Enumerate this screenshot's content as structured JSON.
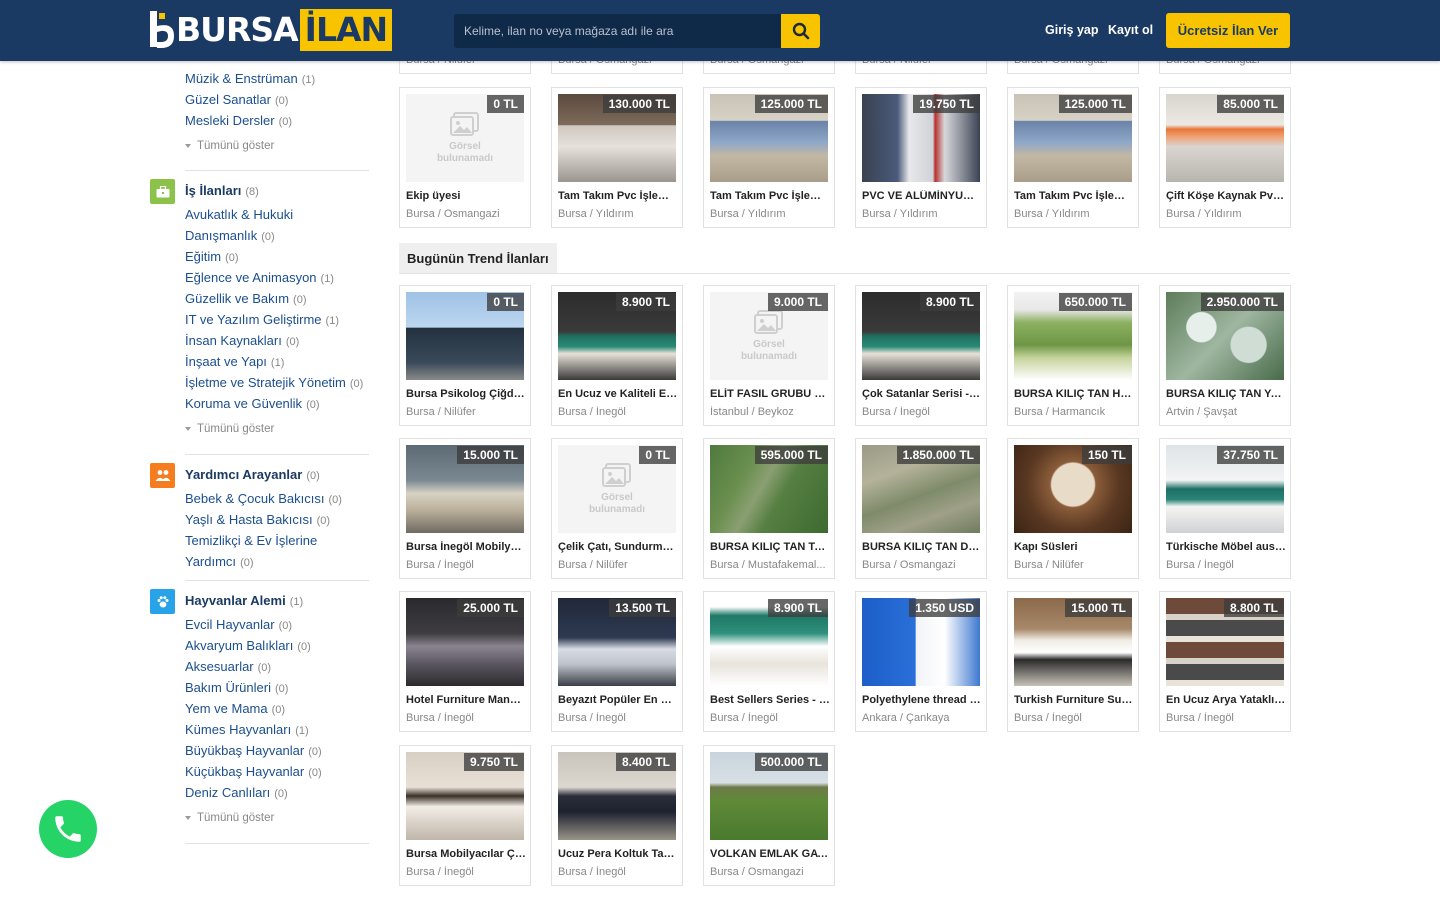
{
  "header": {
    "brand_prefix": "BURSA",
    "brand_suffix": "İLAN",
    "search_placeholder": "Kelime, ilan no veya mağaza adı ile ara",
    "login": "Giriş yap",
    "register": "Kayıt ol",
    "cta": "Ücretsiz İlan Ver"
  },
  "sidebar": {
    "top_items": [
      {
        "label": "Müzik & Enstrüman",
        "count": "(1)"
      },
      {
        "label": "Güzel Sanatlar",
        "count": "(0)"
      },
      {
        "label": "Mesleki Dersler",
        "count": "(0)"
      }
    ],
    "show_all": "Tümünü göster",
    "jobs": {
      "title": "İş İlanları",
      "count": "(8)",
      "items": [
        {
          "label": "Avukatlık & Hukuki",
          "count": ""
        },
        {
          "label": "Danışmanlık",
          "count": "(0)"
        },
        {
          "label": "Eğitim",
          "count": "(0)"
        },
        {
          "label": "Eğlence ve Animasyon",
          "count": "(1)"
        },
        {
          "label": "Güzellik ve Bakım",
          "count": "(0)"
        },
        {
          "label": "IT ve Yazılım Geliştirme",
          "count": "(1)"
        },
        {
          "label": "İnsan Kaynakları",
          "count": "(0)"
        },
        {
          "label": "İnşaat ve Yapı",
          "count": "(1)"
        },
        {
          "label": "İşletme ve Stratejik Yönetim",
          "count": "(0)"
        },
        {
          "label": "Koruma ve Güvenlik",
          "count": "(0)"
        }
      ]
    },
    "helpers": {
      "title": "Yardımcı Arayanlar",
      "count": "(0)",
      "items": [
        {
          "label": "Bebek & Çocuk Bakıcısı",
          "count": "(0)"
        },
        {
          "label": "Yaşlı & Hasta Bakıcısı",
          "count": "(0)"
        },
        {
          "label": "Temizlikçi & Ev İşlerine",
          "count": ""
        },
        {
          "label": "Yardımcı",
          "count": "(0)"
        }
      ]
    },
    "animals": {
      "title": "Hayvanlar Alemi",
      "count": "(1)",
      "items": [
        {
          "label": "Evcil Hayvanlar",
          "count": "(0)"
        },
        {
          "label": "Akvaryum Balıkları",
          "count": "(0)"
        },
        {
          "label": "Aksesuarlar",
          "count": "(0)"
        },
        {
          "label": "Bakım Ürünleri",
          "count": "(0)"
        },
        {
          "label": "Yem ve Mama",
          "count": "(0)"
        },
        {
          "label": "Kümes Hayvanları",
          "count": "(1)"
        },
        {
          "label": "Büyükbaş Hayvanlar",
          "count": "(0)"
        },
        {
          "label": "Küçükbaş Hayvanlar",
          "count": "(0)"
        },
        {
          "label": "Deniz Canlıları",
          "count": "(0)"
        }
      ]
    }
  },
  "top_partial_locations": [
    "Bursa / Nilüfer",
    "Bursa / Osmangazi",
    "Bursa / Osmangazi",
    "Bursa / Nilüfer",
    "Bursa / Osmangazi",
    "Bursa / Osmangazi"
  ],
  "no_image_text": [
    "Görsel",
    "bulunamadı"
  ],
  "listings_row": [
    {
      "price": "0 TL",
      "title": "Ekip üyesi",
      "loc": "Bursa / Osmangazi",
      "img": "none"
    },
    {
      "price": "130.000 TL",
      "title": "Tam Takım Pvc İşleme ...",
      "loc": "Bursa / Yıldırım",
      "img": "factory"
    },
    {
      "price": "125.000 TL",
      "title": "Tam Takım Pvc İşleme ...",
      "loc": "Bursa / Yıldırım",
      "img": "factory2"
    },
    {
      "price": "19.750 TL",
      "title": "PVC VE ALÜMİNYUM ...",
      "loc": "Bursa / Yıldırım",
      "img": "machine"
    },
    {
      "price": "125.000 TL",
      "title": "Tam Takım Pvc İşleme ...",
      "loc": "Bursa / Yıldırım",
      "img": "factory2"
    },
    {
      "price": "85.000 TL",
      "title": "Çift Köşe Kaynak Pvc ...",
      "loc": "Bursa / Yıldırım",
      "img": "factory3"
    }
  ],
  "trend_title": "Bugünün Trend İlanları",
  "trend": [
    {
      "price": "0 TL",
      "title": "Bursa Psikolog Çiğde...",
      "loc": "Bursa / Nilüfer",
      "img": "building"
    },
    {
      "price": "8.900 TL",
      "title": "En Ucuz ve Kaliteli Ela ...",
      "loc": "Bursa / İnegöl",
      "img": "sofa"
    },
    {
      "price": "9.000 TL",
      "title": "ELİT FASIL GRUBU FA...",
      "loc": "İstanbul / Beykoz",
      "img": "none"
    },
    {
      "price": "8.900 TL",
      "title": "Çok Satanlar Serisi - E...",
      "loc": "Bursa / İnegöl",
      "img": "sofa"
    },
    {
      "price": "650.000 TL",
      "title": "BURSA KILIÇ TAN HA...",
      "loc": "Bursa / Harmancık",
      "img": "field"
    },
    {
      "price": "2.950.000 TL",
      "title": "BURSA KILIÇ TAN YA...",
      "loc": "Artvin / Şavşat",
      "img": "aerial"
    },
    {
      "price": "15.000 TL",
      "title": "Bursa İnegöl Mobilya F...",
      "loc": "Bursa / İnegöl",
      "img": "livingroom"
    },
    {
      "price": "0 TL",
      "title": "Çelik Çatı, Sundurma, ...",
      "loc": "Bursa / Nilüfer",
      "img": "none"
    },
    {
      "price": "595.000 TL",
      "title": "BURSA KILIÇ TAN TA...",
      "loc": "Bursa / Mustafakemal...",
      "img": "aerial2"
    },
    {
      "price": "1.850.000 TL",
      "title": "BURSA KILIÇ TAN DE...",
      "loc": "Bursa / Osmangazi",
      "img": "aerial3"
    },
    {
      "price": "150 TL",
      "title": "Kapı Süsleri",
      "loc": "Bursa / Nilüfer",
      "img": "macrame"
    },
    {
      "price": "37.750 TL",
      "title": "Türkische Möbel aus d...",
      "loc": "Bursa / İnegöl",
      "img": "greensofa"
    },
    {
      "price": "25.000 TL",
      "title": "Hotel Furniture Manuf...",
      "loc": "Bursa / İnegöl",
      "img": "bedroom"
    },
    {
      "price": "13.500 TL",
      "title": "Beyazıt Popüler En Ço...",
      "loc": "Bursa / İnegöl",
      "img": "bedroom2"
    },
    {
      "price": "8.900 TL",
      "title": "Best Sellers Series - Th...",
      "loc": "Bursa / İnegöl",
      "img": "sofaset"
    },
    {
      "price": "1.350 USD",
      "title": "Polyethylene thread f...",
      "loc": "Ankara / Çankaya",
      "img": "thread"
    },
    {
      "price": "15.000 TL",
      "title": "Turkish Furniture Suit...",
      "loc": "Bursa / İnegöl",
      "img": "corner"
    },
    {
      "price": "8.800 TL",
      "title": "En Ucuz Arya Yataklı K...",
      "loc": "Bursa / İnegöl",
      "img": "collage"
    },
    {
      "price": "9.750 TL",
      "title": "Bursa Mobilyacılar Ça...",
      "loc": "Bursa / İnegöl",
      "img": "bedroom3"
    },
    {
      "price": "8.400 TL",
      "title": "Ucuz Pera Koltuk Takı...",
      "loc": "Bursa / İnegöl",
      "img": "darksofa"
    },
    {
      "price": "500.000 TL",
      "title": "VOLKAN EMLAK GAY...",
      "loc": "Bursa / Osmangazi",
      "img": "meadow"
    }
  ],
  "colors": {
    "header": "#1b3a63",
    "accent": "#f8c400",
    "link": "#1b4f8f",
    "jobs_icon": "#8bc34a",
    "helpers_icon": "#f57c1f",
    "animals_icon": "#29a3e8",
    "whatsapp": "#25d366"
  }
}
